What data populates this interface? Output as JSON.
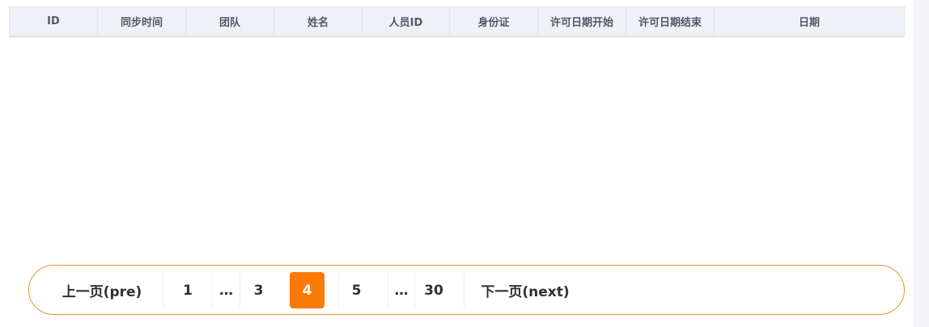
{
  "table": {
    "columns": [
      "ID",
      "同步时间",
      "团队",
      "姓名",
      "人员ID",
      "身份证",
      "许可日期开始",
      "许可日期结束",
      "日期"
    ]
  },
  "pagination": {
    "prev_label": "上一页(pre)",
    "next_label": "下一页(next)",
    "pages": [
      "1",
      "…",
      "3",
      "4",
      "5",
      "…",
      "30"
    ],
    "current_page": "4",
    "accent_color": "#fc7a08",
    "border_color": "#e0922f"
  }
}
